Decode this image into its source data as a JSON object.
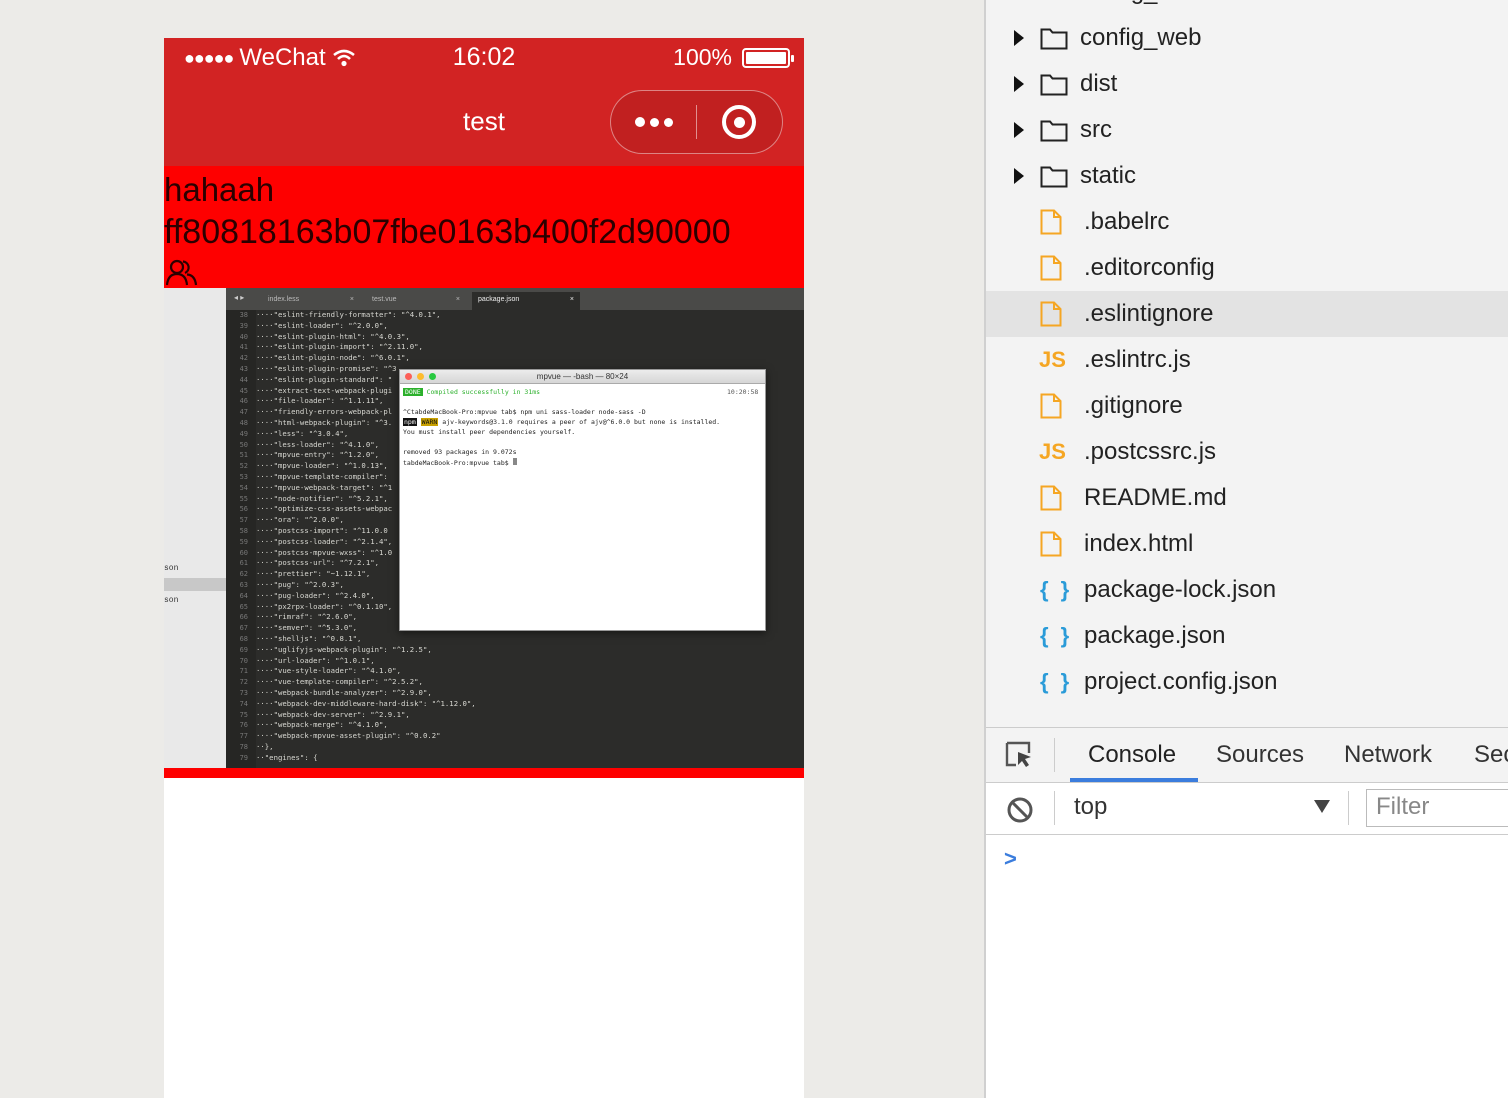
{
  "simulator": {
    "status": {
      "carrier": "WeChat",
      "signal_dots": "●●●●●",
      "time": "16:02",
      "battery": "100%"
    },
    "nav_title": "test",
    "content": {
      "line1": "hahaah",
      "line2": "ff80818163b07fbe0163b400f2d90000"
    },
    "embedded_image": {
      "tabs": [
        "index.less",
        "test.vue",
        "package.json"
      ],
      "sidebar": [
        "son",
        "son"
      ],
      "line_numbers": [
        "38",
        "39",
        "40",
        "41",
        "42",
        "43",
        "44",
        "45",
        "46",
        "47",
        "48",
        "49",
        "50",
        "51",
        "52",
        "53",
        "54",
        "55",
        "56",
        "57",
        "58",
        "59",
        "60",
        "61",
        "62",
        "63",
        "64",
        "65",
        "66",
        "67",
        "68",
        "69",
        "70",
        "71",
        "72",
        "73",
        "74",
        "75",
        "76",
        "77",
        "78",
        "79"
      ],
      "code_lines": [
        "····\"eslint-friendly-formatter\": \"^4.0.1\",",
        "····\"eslint-loader\": \"^2.0.0\",",
        "····\"eslint-plugin-html\": \"^4.0.3\",",
        "····\"eslint-plugin-import\": \"^2.11.0\",",
        "····\"eslint-plugin-node\": \"^6.0.1\",",
        "····\"eslint-plugin-promise\": \"^3",
        "····\"eslint-plugin-standard\": \"",
        "····\"extract-text-webpack-plugi",
        "····\"file-loader\": \"^1.1.11\",",
        "····\"friendly-errors-webpack-pl",
        "····\"html-webpack-plugin\": \"^3.",
        "····\"less\": \"^3.0.4\",",
        "····\"less-loader\": \"^4.1.0\",",
        "····\"mpvue-entry\": \"^1.2.0\",",
        "····\"mpvue-loader\": \"^1.0.13\",",
        "····\"mpvue-template-compiler\":",
        "····\"mpvue-webpack-target\": \"^1",
        "····\"node-notifier\": \"^5.2.1\",",
        "····\"optimize-css-assets-webpac",
        "····\"ora\": \"^2.0.0\",",
        "····\"postcss-import\": \"^11.0.0",
        "····\"postcss-loader\": \"^2.1.4\",",
        "····\"postcss-mpvue-wxss\": \"^1.0",
        "····\"postcss-url\": \"^7.2.1\",",
        "····\"prettier\": \"~1.12.1\",",
        "····\"pug\": \"^2.0.3\",",
        "····\"pug-loader\": \"^2.4.0\",",
        "····\"px2rpx-loader\": \"^0.1.10\",",
        "····\"rimraf\": \"^2.6.0\",",
        "····\"semver\": \"^5.3.0\",",
        "····\"shelljs\": \"^0.8.1\",",
        "····\"uglifyjs-webpack-plugin\": \"^1.2.5\",",
        "····\"url-loader\": \"^1.0.1\",",
        "····\"vue-style-loader\": \"^4.1.0\",",
        "····\"vue-template-compiler\": \"^2.5.2\",",
        "····\"webpack-bundle-analyzer\": \"^2.9.0\",",
        "····\"webpack-dev-middleware-hard-disk\": \"^1.12.0\",",
        "····\"webpack-dev-server\": \"^2.9.1\",",
        "····\"webpack-merge\": \"^4.1.0\",",
        "····\"webpack-mpvue-asset-plugin\": \"^0.0.2\"",
        "··},",
        "··\"engines\": {"
      ],
      "terminal": {
        "title": "mpvue — -bash — 80×24",
        "done_badge": "DONE",
        "compiled": "Compiled successfully in 31ms",
        "time": "10:20:58",
        "cmd": "^CtabdeMacBook-Pro:mpvue tab$ npm uni sass-loader node-sass -D",
        "npm_badge": "npm",
        "warn_badge": "WARN",
        "warn": "ajv-keywords@3.1.0 requires a peer of ajv@^6.0.0 but none is installed.",
        "warn2": " You must install peer dependencies yourself.",
        "removed": "removed 93 packages in 9.072s",
        "prompt": "tabdeMacBook-Pro:mpvue tab$"
      }
    }
  },
  "devtools": {
    "partial_top": "config_base",
    "tree": [
      {
        "name": "config_web",
        "type": "folder"
      },
      {
        "name": "dist",
        "type": "folder"
      },
      {
        "name": "src",
        "type": "folder"
      },
      {
        "name": "static",
        "type": "folder"
      },
      {
        "name": ".babelrc",
        "type": "file"
      },
      {
        "name": ".editorconfig",
        "type": "file"
      },
      {
        "name": ".eslintignore",
        "type": "file",
        "selected": true
      },
      {
        "name": ".eslintrc.js",
        "type": "js"
      },
      {
        "name": ".gitignore",
        "type": "file"
      },
      {
        "name": ".postcssrc.js",
        "type": "js"
      },
      {
        "name": "README.md",
        "type": "file"
      },
      {
        "name": "index.html",
        "type": "file"
      },
      {
        "name": "package-lock.json",
        "type": "json"
      },
      {
        "name": "package.json",
        "type": "json"
      },
      {
        "name": "project.config.json",
        "type": "json"
      }
    ],
    "icons": {
      "js": "JS",
      "json": "{ }"
    },
    "tabs": [
      "Console",
      "Sources",
      "Network",
      "Sec"
    ],
    "active_tab": "Console",
    "context": "top",
    "filter_placeholder": "Filter",
    "prompt_glyph": ">"
  },
  "colors": {
    "wechat_header": "#d22323",
    "content_red": "#fe0000",
    "accent_blue": "#3b7ddd",
    "file_orange": "#f5a623",
    "json_blue": "#2a9bd8"
  }
}
